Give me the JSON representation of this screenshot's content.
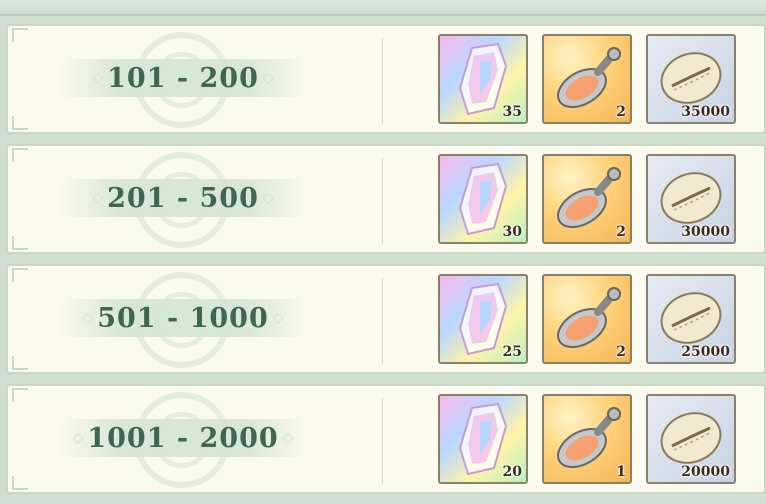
{
  "rows": [
    {
      "range": "101 - 200",
      "rewards": {
        "crystal": "35",
        "bottle": "2",
        "shell": "35000"
      }
    },
    {
      "range": "201 - 500",
      "rewards": {
        "crystal": "30",
        "bottle": "2",
        "shell": "30000"
      }
    },
    {
      "range": "501 - 1000",
      "rewards": {
        "crystal": "25",
        "bottle": "2",
        "shell": "25000"
      }
    },
    {
      "range": "1001 - 2000",
      "rewards": {
        "crystal": "20",
        "bottle": "1",
        "shell": "20000"
      }
    }
  ],
  "icons": {
    "crystal": "rainbow-crystal-icon",
    "bottle": "potion-bottle-icon",
    "shell": "cowrie-shell-icon"
  },
  "colors": {
    "rank_text": "#3f6650",
    "row_bg": "#fbfaee",
    "row_border": "#c7d8c6"
  }
}
